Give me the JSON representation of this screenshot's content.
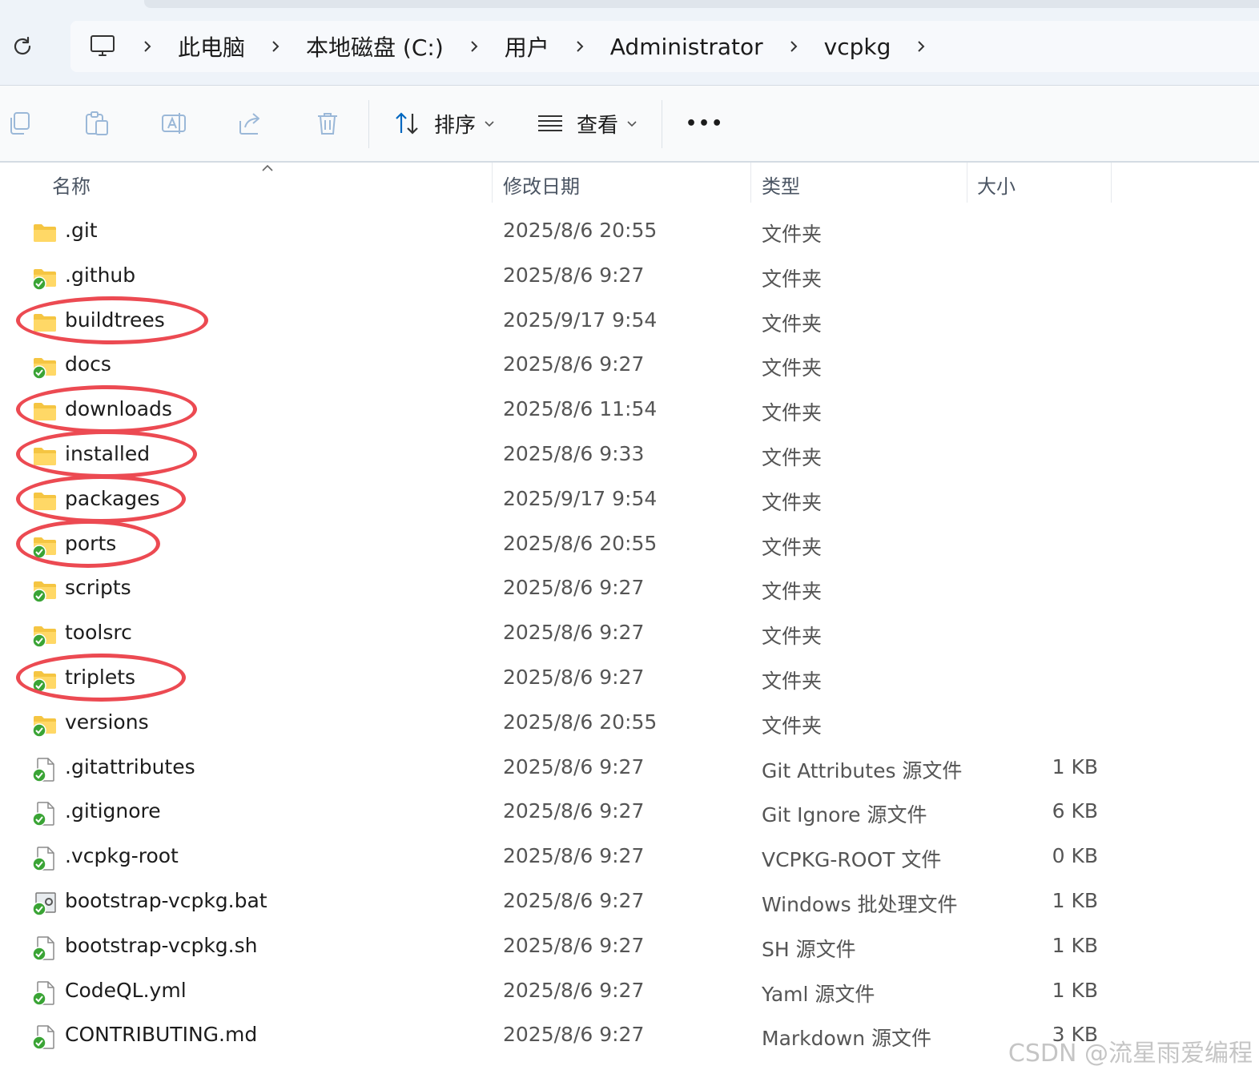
{
  "address_bar": {
    "breadcrumb": [
      "此电脑",
      "本地磁盘 (C:)",
      "用户",
      "Administrator",
      "vcpkg"
    ]
  },
  "toolbar": {
    "sort_label": "排序",
    "view_label": "查看",
    "more_label": "•••"
  },
  "columns": {
    "name": "名称",
    "modified": "修改日期",
    "type": "类型",
    "size": "大小"
  },
  "files": [
    {
      "name": ".git",
      "modified": "2025/8/6 20:55",
      "type": "文件夹",
      "size": "",
      "icon": "folder-icon",
      "circled": false
    },
    {
      "name": ".github",
      "modified": "2025/8/6 9:27",
      "type": "文件夹",
      "size": "",
      "icon": "folder-synced-icon",
      "circled": false
    },
    {
      "name": "buildtrees",
      "modified": "2025/9/17 9:54",
      "type": "文件夹",
      "size": "",
      "icon": "folder-icon",
      "circled": true
    },
    {
      "name": "docs",
      "modified": "2025/8/6 9:27",
      "type": "文件夹",
      "size": "",
      "icon": "folder-synced-icon",
      "circled": false
    },
    {
      "name": "downloads",
      "modified": "2025/8/6 11:54",
      "type": "文件夹",
      "size": "",
      "icon": "folder-icon",
      "circled": true
    },
    {
      "name": "installed",
      "modified": "2025/8/6 9:33",
      "type": "文件夹",
      "size": "",
      "icon": "folder-icon",
      "circled": true
    },
    {
      "name": "packages",
      "modified": "2025/9/17 9:54",
      "type": "文件夹",
      "size": "",
      "icon": "folder-icon",
      "circled": true
    },
    {
      "name": "ports",
      "modified": "2025/8/6 20:55",
      "type": "文件夹",
      "size": "",
      "icon": "folder-synced-icon",
      "circled": true
    },
    {
      "name": "scripts",
      "modified": "2025/8/6 9:27",
      "type": "文件夹",
      "size": "",
      "icon": "folder-synced-icon",
      "circled": false
    },
    {
      "name": "toolsrc",
      "modified": "2025/8/6 9:27",
      "type": "文件夹",
      "size": "",
      "icon": "folder-synced-icon",
      "circled": false
    },
    {
      "name": "triplets",
      "modified": "2025/8/6 9:27",
      "type": "文件夹",
      "size": "",
      "icon": "folder-synced-icon",
      "circled": true
    },
    {
      "name": "versions",
      "modified": "2025/8/6 20:55",
      "type": "文件夹",
      "size": "",
      "icon": "folder-synced-icon",
      "circled": false
    },
    {
      "name": ".gitattributes",
      "modified": "2025/8/6 9:27",
      "type": "Git Attributes 源文件",
      "size": "1 KB",
      "icon": "file-synced-icon",
      "circled": false
    },
    {
      "name": ".gitignore",
      "modified": "2025/8/6 9:27",
      "type": "Git Ignore 源文件",
      "size": "6 KB",
      "icon": "file-synced-icon",
      "circled": false
    },
    {
      "name": ".vcpkg-root",
      "modified": "2025/8/6 9:27",
      "type": "VCPKG-ROOT 文件",
      "size": "0 KB",
      "icon": "file-synced-icon",
      "circled": false
    },
    {
      "name": "bootstrap-vcpkg.bat",
      "modified": "2025/8/6 9:27",
      "type": "Windows 批处理文件",
      "size": "1 KB",
      "icon": "batch-file-synced-icon",
      "circled": false
    },
    {
      "name": "bootstrap-vcpkg.sh",
      "modified": "2025/8/6 9:27",
      "type": "SH 源文件",
      "size": "1 KB",
      "icon": "file-synced-icon",
      "circled": false
    },
    {
      "name": "CodeQL.yml",
      "modified": "2025/8/6 9:27",
      "type": "Yaml 源文件",
      "size": "1 KB",
      "icon": "file-synced-icon",
      "circled": false
    },
    {
      "name": "CONTRIBUTING.md",
      "modified": "2025/8/6 9:27",
      "type": "Markdown 源文件",
      "size": "3 KB",
      "icon": "file-synced-icon",
      "circled": false
    }
  ],
  "watermark": "CSDN @流星雨爱编程",
  "colors": {
    "annotation_circle": "#ec4a52",
    "folder_yellow": "#f5c542",
    "sync_green": "#3aa435",
    "accent": "#0067c0"
  }
}
